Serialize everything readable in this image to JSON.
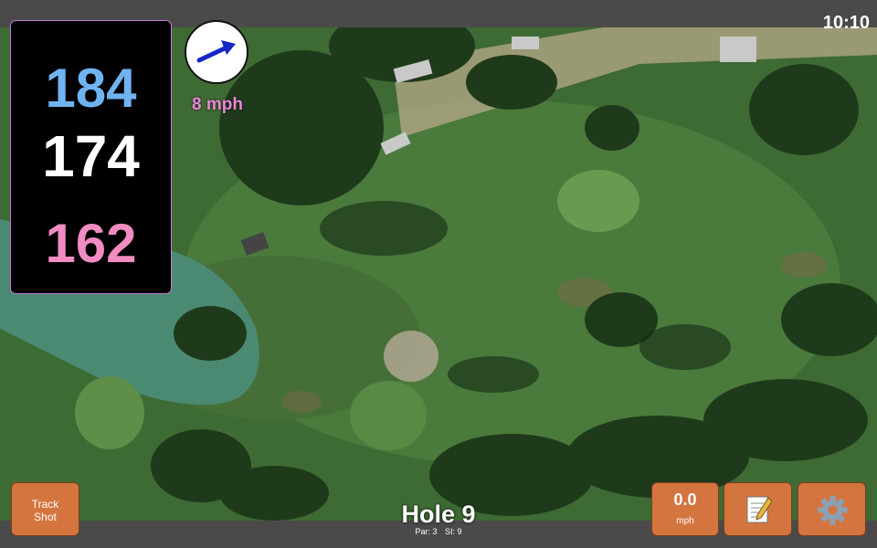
{
  "status": {
    "time": "10:10"
  },
  "distances": {
    "back": "184",
    "middle": "174",
    "front": "162"
  },
  "wind": {
    "speed_label": "8 mph",
    "arrow_icon": "arrow-icon"
  },
  "buttons": {
    "track_shot_line1": "Track",
    "track_shot_line2": "Shot",
    "speed_value": "0.0",
    "speed_unit": "mph",
    "notes_icon": "notepad-icon",
    "settings_icon": "gear-icon"
  },
  "hole": {
    "title": "Hole 9",
    "par": "Par: 3",
    "si": "SI: 9"
  },
  "colors": {
    "back": "#6fb4f0",
    "middle": "#ffffff",
    "front": "#f08cc2",
    "button": "#d4753f",
    "wind_label": "#ea88d6"
  }
}
